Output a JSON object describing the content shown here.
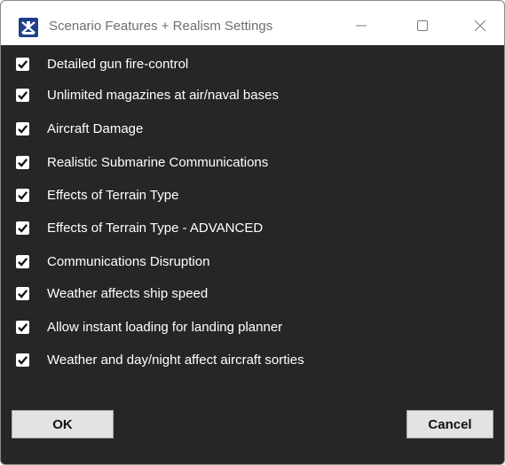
{
  "window": {
    "title": "Scenario Features + Realism Settings",
    "icon": "app-ship-icon",
    "controls": [
      "minimize-icon",
      "maximize-icon",
      "close-icon"
    ]
  },
  "options": [
    {
      "label": "Detailed gun fire-control",
      "checked": true
    },
    {
      "label": "Unlimited magazines at air/naval bases",
      "checked": true
    },
    {
      "label": "Aircraft Damage",
      "checked": true
    },
    {
      "label": "Realistic Submarine Communications",
      "checked": true
    },
    {
      "label": "Effects of Terrain Type",
      "checked": true
    },
    {
      "label": "Effects of Terrain Type - ADVANCED",
      "checked": true
    },
    {
      "label": "Communications Disruption",
      "checked": true
    },
    {
      "label": "Weather affects ship speed",
      "checked": true
    },
    {
      "label": "Allow instant loading for landing planner",
      "checked": true
    },
    {
      "label": "Weather and day/night affect aircraft sorties",
      "checked": true
    }
  ],
  "buttons": {
    "ok": "OK",
    "cancel": "Cancel"
  },
  "colors": {
    "background": "#262626",
    "text": "#ffffff",
    "titlebar": "#ffffff",
    "button": "#e3e3e3"
  }
}
